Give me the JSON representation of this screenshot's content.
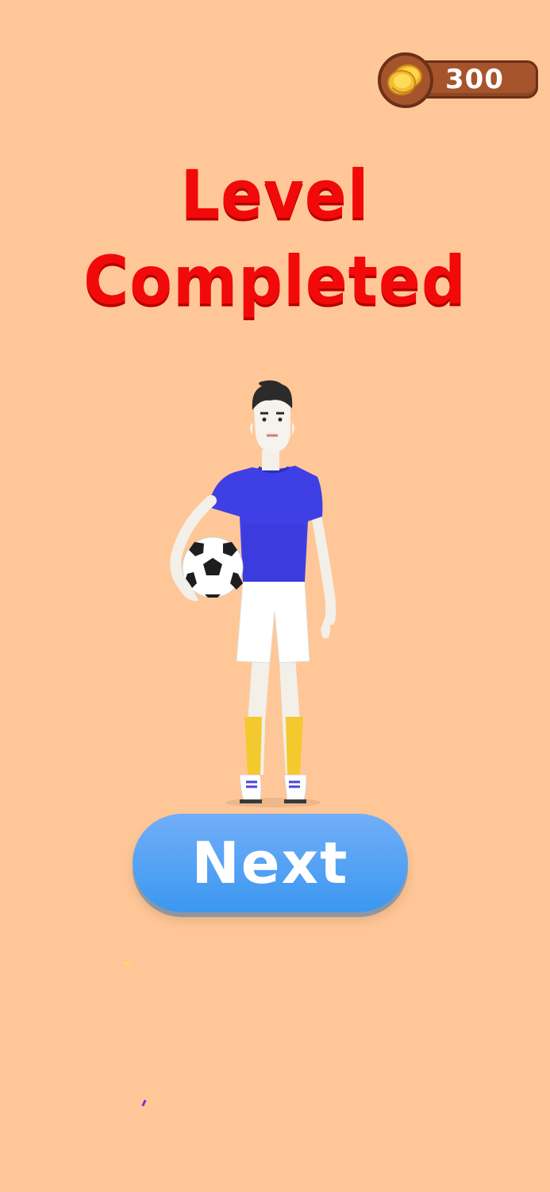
{
  "screen": {
    "background_color": "#FFC797"
  },
  "coins": {
    "value": "300",
    "icon": "coin-stack-icon",
    "pill_color": "#A6542C"
  },
  "title": {
    "text": "Level Completed",
    "color": "#F20A0A"
  },
  "character": {
    "icon": "soccer-player",
    "holding": "soccer-ball-icon",
    "shirt_color": "#3F3FE6",
    "shorts_color": "#FFFFFF",
    "socks_color": "#F4C92E"
  },
  "next_button": {
    "label": "Next",
    "color": "#3B98F0"
  }
}
